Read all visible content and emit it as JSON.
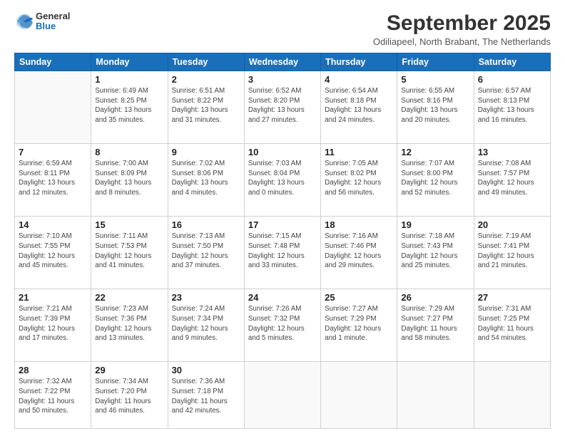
{
  "logo": {
    "general": "General",
    "blue": "Blue"
  },
  "header": {
    "title": "September 2025",
    "subtitle": "Odiliapeel, North Brabant, The Netherlands"
  },
  "weekdays": [
    "Sunday",
    "Monday",
    "Tuesday",
    "Wednesday",
    "Thursday",
    "Friday",
    "Saturday"
  ],
  "weeks": [
    [
      {
        "day": "",
        "info": ""
      },
      {
        "day": "1",
        "info": "Sunrise: 6:49 AM\nSunset: 8:25 PM\nDaylight: 13 hours\nand 35 minutes."
      },
      {
        "day": "2",
        "info": "Sunrise: 6:51 AM\nSunset: 8:22 PM\nDaylight: 13 hours\nand 31 minutes."
      },
      {
        "day": "3",
        "info": "Sunrise: 6:52 AM\nSunset: 8:20 PM\nDaylight: 13 hours\nand 27 minutes."
      },
      {
        "day": "4",
        "info": "Sunrise: 6:54 AM\nSunset: 8:18 PM\nDaylight: 13 hours\nand 24 minutes."
      },
      {
        "day": "5",
        "info": "Sunrise: 6:55 AM\nSunset: 8:16 PM\nDaylight: 13 hours\nand 20 minutes."
      },
      {
        "day": "6",
        "info": "Sunrise: 6:57 AM\nSunset: 8:13 PM\nDaylight: 13 hours\nand 16 minutes."
      }
    ],
    [
      {
        "day": "7",
        "info": "Sunrise: 6:59 AM\nSunset: 8:11 PM\nDaylight: 13 hours\nand 12 minutes."
      },
      {
        "day": "8",
        "info": "Sunrise: 7:00 AM\nSunset: 8:09 PM\nDaylight: 13 hours\nand 8 minutes."
      },
      {
        "day": "9",
        "info": "Sunrise: 7:02 AM\nSunset: 8:06 PM\nDaylight: 13 hours\nand 4 minutes."
      },
      {
        "day": "10",
        "info": "Sunrise: 7:03 AM\nSunset: 8:04 PM\nDaylight: 13 hours\nand 0 minutes."
      },
      {
        "day": "11",
        "info": "Sunrise: 7:05 AM\nSunset: 8:02 PM\nDaylight: 12 hours\nand 56 minutes."
      },
      {
        "day": "12",
        "info": "Sunrise: 7:07 AM\nSunset: 8:00 PM\nDaylight: 12 hours\nand 52 minutes."
      },
      {
        "day": "13",
        "info": "Sunrise: 7:08 AM\nSunset: 7:57 PM\nDaylight: 12 hours\nand 49 minutes."
      }
    ],
    [
      {
        "day": "14",
        "info": "Sunrise: 7:10 AM\nSunset: 7:55 PM\nDaylight: 12 hours\nand 45 minutes."
      },
      {
        "day": "15",
        "info": "Sunrise: 7:11 AM\nSunset: 7:53 PM\nDaylight: 12 hours\nand 41 minutes."
      },
      {
        "day": "16",
        "info": "Sunrise: 7:13 AM\nSunset: 7:50 PM\nDaylight: 12 hours\nand 37 minutes."
      },
      {
        "day": "17",
        "info": "Sunrise: 7:15 AM\nSunset: 7:48 PM\nDaylight: 12 hours\nand 33 minutes."
      },
      {
        "day": "18",
        "info": "Sunrise: 7:16 AM\nSunset: 7:46 PM\nDaylight: 12 hours\nand 29 minutes."
      },
      {
        "day": "19",
        "info": "Sunrise: 7:18 AM\nSunset: 7:43 PM\nDaylight: 12 hours\nand 25 minutes."
      },
      {
        "day": "20",
        "info": "Sunrise: 7:19 AM\nSunset: 7:41 PM\nDaylight: 12 hours\nand 21 minutes."
      }
    ],
    [
      {
        "day": "21",
        "info": "Sunrise: 7:21 AM\nSunset: 7:39 PM\nDaylight: 12 hours\nand 17 minutes."
      },
      {
        "day": "22",
        "info": "Sunrise: 7:23 AM\nSunset: 7:36 PM\nDaylight: 12 hours\nand 13 minutes."
      },
      {
        "day": "23",
        "info": "Sunrise: 7:24 AM\nSunset: 7:34 PM\nDaylight: 12 hours\nand 9 minutes."
      },
      {
        "day": "24",
        "info": "Sunrise: 7:26 AM\nSunset: 7:32 PM\nDaylight: 12 hours\nand 5 minutes."
      },
      {
        "day": "25",
        "info": "Sunrise: 7:27 AM\nSunset: 7:29 PM\nDaylight: 12 hours\nand 1 minute."
      },
      {
        "day": "26",
        "info": "Sunrise: 7:29 AM\nSunset: 7:27 PM\nDaylight: 11 hours\nand 58 minutes."
      },
      {
        "day": "27",
        "info": "Sunrise: 7:31 AM\nSunset: 7:25 PM\nDaylight: 11 hours\nand 54 minutes."
      }
    ],
    [
      {
        "day": "28",
        "info": "Sunrise: 7:32 AM\nSunset: 7:22 PM\nDaylight: 11 hours\nand 50 minutes."
      },
      {
        "day": "29",
        "info": "Sunrise: 7:34 AM\nSunset: 7:20 PM\nDaylight: 11 hours\nand 46 minutes."
      },
      {
        "day": "30",
        "info": "Sunrise: 7:36 AM\nSunset: 7:18 PM\nDaylight: 11 hours\nand 42 minutes."
      },
      {
        "day": "",
        "info": ""
      },
      {
        "day": "",
        "info": ""
      },
      {
        "day": "",
        "info": ""
      },
      {
        "day": "",
        "info": ""
      }
    ]
  ]
}
